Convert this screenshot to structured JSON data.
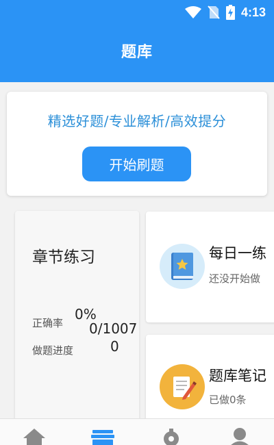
{
  "status_bar": {
    "time": "4:13"
  },
  "header": {
    "title": "题库"
  },
  "promo": {
    "slogan": "精选好题/专业解析/高效提分",
    "start_button": "开始刷题"
  },
  "chapter": {
    "title": "章节练习",
    "accuracy_label": "正确率",
    "accuracy_value": "0%",
    "progress_count": "0/1007",
    "progress_label": "做题进度",
    "progress_value": "0"
  },
  "daily": {
    "title": "每日一练",
    "subtitle": "还没开始做"
  },
  "notes": {
    "title": "题库笔记",
    "subtitle": "已做0条"
  },
  "colors": {
    "primary": "#2b93f5",
    "slogan": "#2b8fd8",
    "note_icon_bg": "#f2b33c",
    "daily_icon_bg": "#d6ecfa"
  },
  "nav": {
    "items": [
      {
        "icon": "home-icon",
        "active": false
      },
      {
        "icon": "question-bank-icon",
        "active": true
      },
      {
        "icon": "discover-icon",
        "active": false
      },
      {
        "icon": "profile-icon",
        "active": false
      }
    ]
  }
}
